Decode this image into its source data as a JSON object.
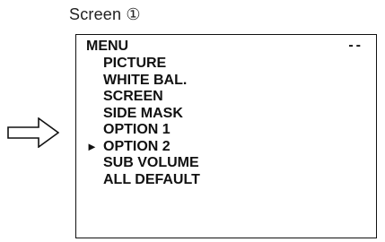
{
  "screen_label": "Screen ①",
  "arrow_icon": "right-outline-arrow-icon",
  "menu": {
    "title": "MENU",
    "indicator": "--",
    "cursor_symbol": "►",
    "selected_index": 5,
    "items": [
      {
        "label": "PICTURE"
      },
      {
        "label": "WHITE BAL."
      },
      {
        "label": "SCREEN"
      },
      {
        "label": "SIDE MASK"
      },
      {
        "label": "OPTION 1"
      },
      {
        "label": "OPTION 2"
      },
      {
        "label": "SUB VOLUME"
      },
      {
        "label": "ALL DEFAULT"
      }
    ]
  }
}
